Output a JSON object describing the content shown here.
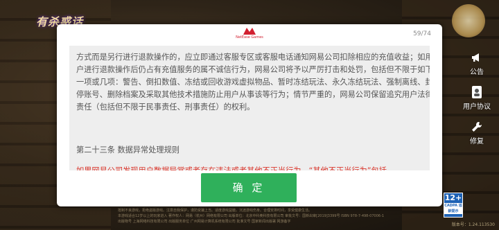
{
  "game": {
    "logo_text": "有杀惑话"
  },
  "side_menu": [
    {
      "icon": "megaphone-icon",
      "label": "公告"
    },
    {
      "icon": "user-agreement-icon",
      "label": "用户协议"
    },
    {
      "icon": "wrench-icon",
      "label": "修复"
    }
  ],
  "dialog": {
    "brand_label": "NetEase Games",
    "page_counter": "59/74",
    "paragraph_1": "方式而是另行进行退款操作的，应立即通过客服专区或客服电话通知网易公司扣除相应的充值收益；如用户进行退款操作后仍占有充值服务的属不诚信行为，网易公司将予以严厉打击和处罚，包括但不限于如下一项或几项：警告、倒扣数值、冻结或回收游戏虚拟物品、暂时冻结玩法、永久冻结玩法、强制离线、封停账号、删除档案及采取其他技术措施防止用户从事该等行为；情节严重的，网易公司保留追究用户法律责任（包括但不限于民事责任、刑事责任）的权利。",
    "section_title": "第二十三条 数据异常处理规则",
    "paragraph_red": "如果网易公司发现用户数据异常或者存在违法或者其他不正当行为，“其他不正当行为”包括",
    "confirm_label": "确 定"
  },
  "footer": {
    "line_1": "抵制不良游戏，拒绝盗版游戏。注意自我保护，谨防受骗上当。适度游戏益脑，沉迷游戏伤身。合理安排时间，享受健康生活。",
    "line_2": "本游戏适合12岁以上的玩家进入 著作权人：网易（杭州）网络有限公司 出版单位：北京中科奥科技有限公司 审批文号：国新出审[2019]3399号 ISBN 978-7-498-07006-1",
    "line_3": "出版物号 上海网络科技有限公司 出版服务单位 广州网易计算机系统有限公司 批准文号 国家新闻出版署 网游备字",
    "age_rating": "12+",
    "age_rating_sub": "CADPA 适龄提示",
    "version": "版本号：1.24.113530"
  },
  "colors": {
    "confirm_green": "#2fb05b",
    "warning_red": "#d9352b",
    "content_bg": "#eeeeee"
  }
}
